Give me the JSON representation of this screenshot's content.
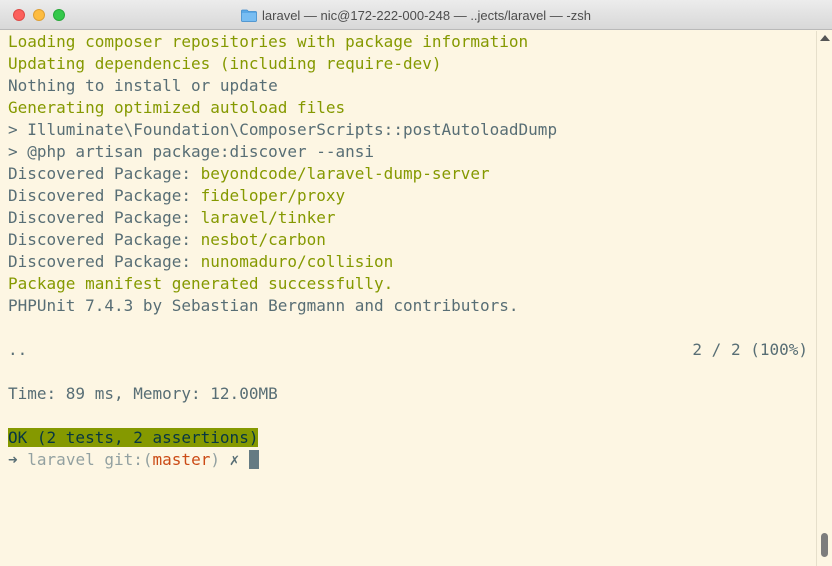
{
  "window": {
    "title": "laravel — nic@172-222-000-248 — ..jects/laravel — -zsh"
  },
  "terminal": {
    "lines": [
      "Loading composer repositories with package information",
      "Updating dependencies (including require-dev)",
      "Nothing to install or update",
      "Generating optimized autoload files",
      "> Illuminate\\Foundation\\ComposerScripts::postAutoloadDump",
      "> @php artisan package:discover --ansi",
      "Discovered Package: ",
      "Discovered Package: ",
      "Discovered Package: ",
      "Discovered Package: ",
      "Discovered Package: ",
      "Package manifest generated successfully.",
      "PHPUnit 7.4.3 by Sebastian Bergmann and contributors.",
      "",
      "..",
      "",
      "Time: 89 ms, Memory: 12.00MB",
      "",
      "OK (2 tests, 2 assertions)"
    ],
    "packages": [
      "beyondcode/laravel-dump-server",
      "fideloper/proxy",
      "laravel/tinker",
      "nesbot/carbon",
      "nunomaduro/collision"
    ],
    "progress_text": "2 / 2 (100%)",
    "prompt": {
      "arrow": "➜",
      "dir": "laravel",
      "git_prefix": "git:(",
      "branch": "master",
      "git_suffix": ")",
      "dirty": "✗"
    }
  },
  "colors": {
    "background": "#fdf6e3",
    "success": "#859900",
    "text": "#586e75",
    "branch": "#cb4b16"
  }
}
